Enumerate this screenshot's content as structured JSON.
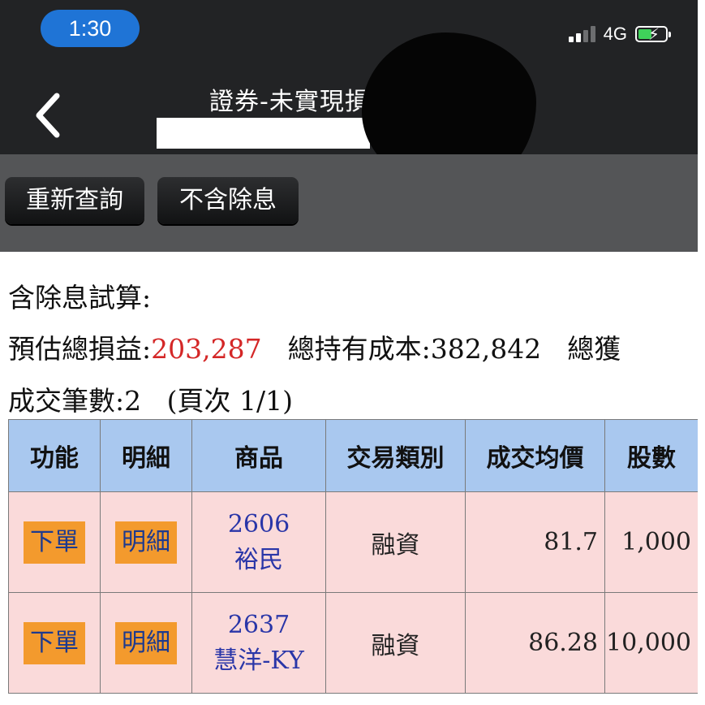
{
  "status_bar": {
    "time": "1:30",
    "network": "4G"
  },
  "nav": {
    "title": "證券-未實現損"
  },
  "toolbar": {
    "requery_label": "重新查詢",
    "exclude_dividend_label": "不含除息"
  },
  "summary": {
    "heading": "含除息試算:",
    "est_pl_label": "預估總損益:",
    "est_pl_value": "203,287",
    "total_cost_label": "總持有成本:",
    "total_cost_value": "382,842",
    "total_profit_label": "總獲",
    "trade_count_label": "成交筆數:",
    "trade_count_value": "2",
    "page_info": "(頁次 1/1)"
  },
  "table": {
    "headers": [
      "功能",
      "明細",
      "商品",
      "交易類別",
      "成交均價",
      "股數"
    ],
    "rows": [
      {
        "order": "下單",
        "detail": "明細",
        "code": "2606",
        "name": "裕民",
        "type": "融資",
        "avg_price": "81.7",
        "shares": "1,000"
      },
      {
        "order": "下單",
        "detail": "明細",
        "code": "2637",
        "name": "慧洋-KY",
        "type": "融資",
        "avg_price": "86.28",
        "shares": "10,000"
      }
    ]
  },
  "colors": {
    "header_bg": "#222325",
    "toolbar_bg": "#545557",
    "table_head": "#a9c8ef",
    "table_row": "#fadada",
    "action_orange": "#f39a2d",
    "profit_red": "#d42727"
  }
}
